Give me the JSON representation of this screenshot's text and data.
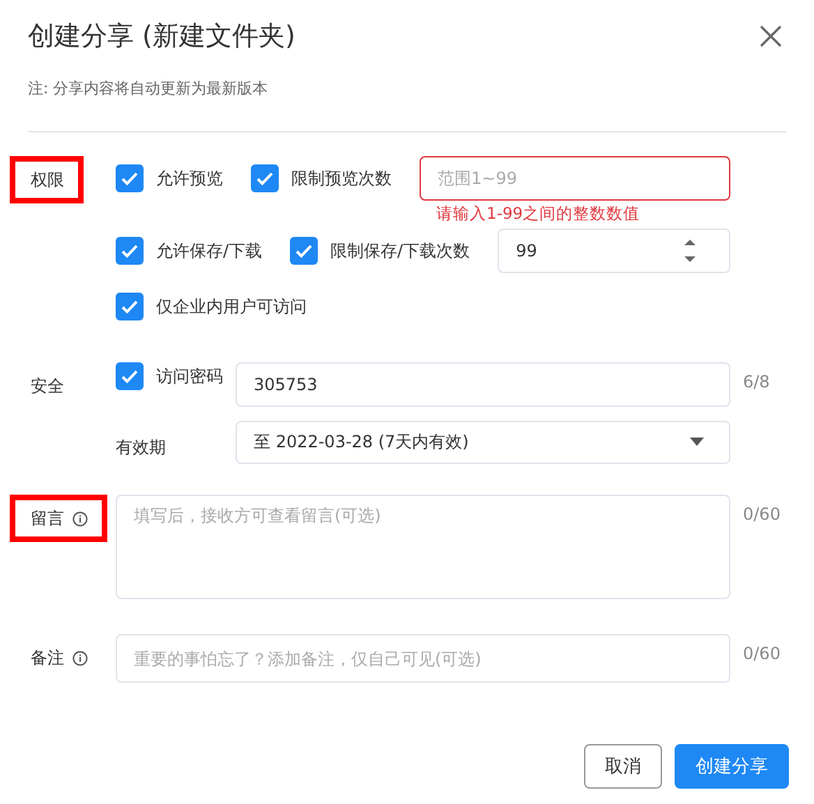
{
  "dialog": {
    "title": "创建分享 (新建文件夹)",
    "note": "注: 分享内容将自动更新为最新版本"
  },
  "permissions": {
    "label": "权限",
    "highlighted": true,
    "rows": [
      [
        {
          "kind": "checkbox",
          "label": "允许预览",
          "checked": true
        },
        {
          "kind": "checkbox",
          "label": "限制预览次数",
          "checked": true
        },
        {
          "kind": "field",
          "placeholder": "范围1~99",
          "error": "请输入1-99之间的整数数值"
        }
      ],
      [
        {
          "kind": "checkbox",
          "label": "允许保存/下载",
          "checked": true
        },
        {
          "kind": "checkbox",
          "label": "限制保存/下载次数",
          "checked": true
        },
        {
          "kind": "number",
          "value": "99"
        }
      ],
      [
        {
          "kind": "checkbox",
          "label": "仅企业内用户可访问",
          "checked": true
        }
      ]
    ]
  },
  "security": {
    "label": "安全",
    "password": {
      "label": "访问密码",
      "checked": true,
      "value": "305753",
      "counter": "6/8"
    },
    "expiry": {
      "label": "有效期",
      "value": "至 2022-03-28 (7天内有效)"
    }
  },
  "message": {
    "label": "留言",
    "highlighted": true,
    "placeholder": "填写后，接收方可查看留言(可选)",
    "counter": "0/60"
  },
  "remark": {
    "label": "备注",
    "highlighted": false,
    "placeholder": "重要的事怕忘了？添加备注，仅自己可见(可选)",
    "counter": "0/60"
  },
  "buttons": [
    {
      "label": "取消",
      "kind": "secondary"
    },
    {
      "label": "创建分享",
      "kind": "primary"
    }
  ]
}
